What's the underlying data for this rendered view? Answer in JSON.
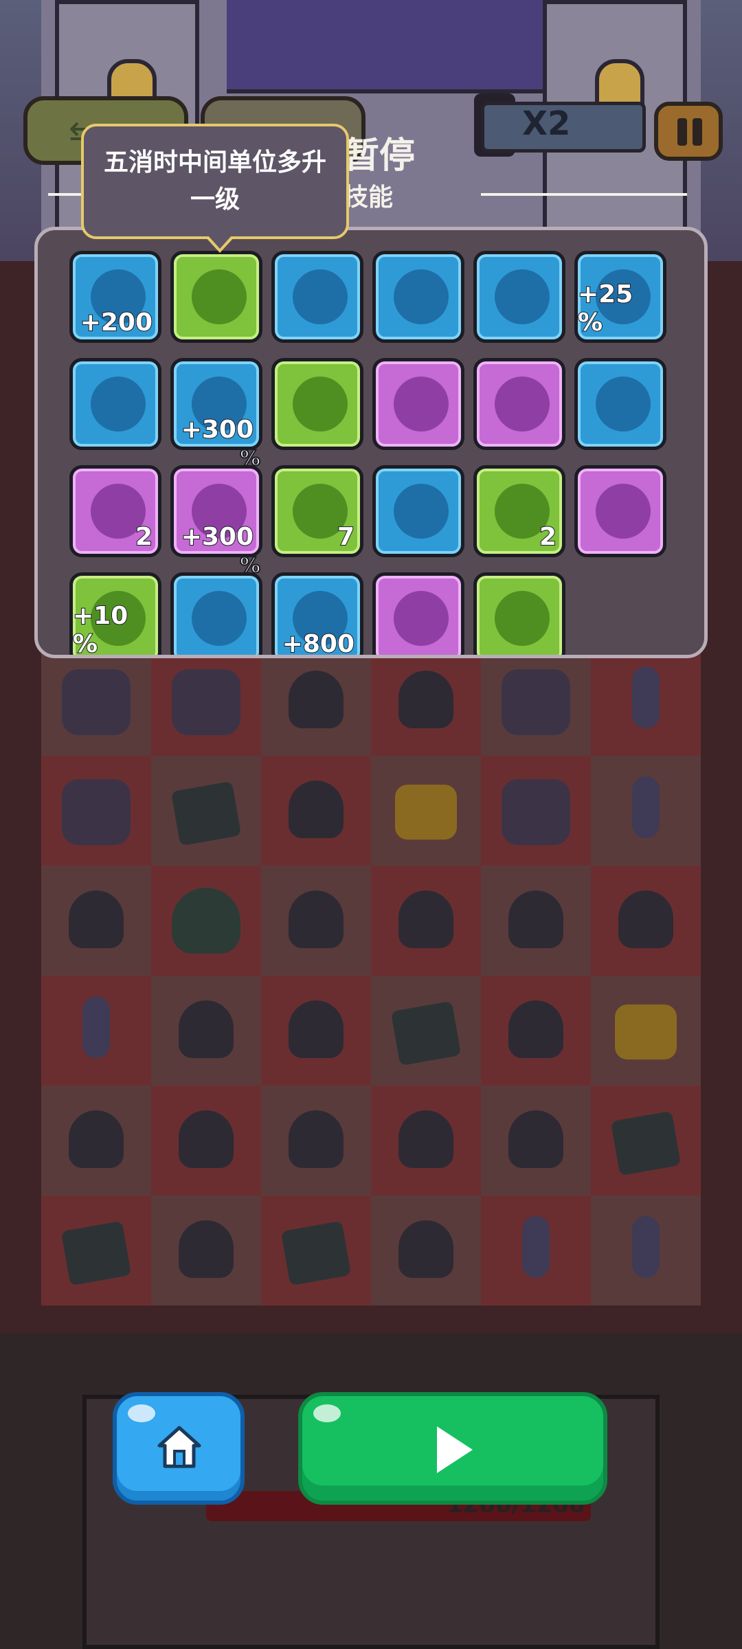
{
  "hud": {
    "speed_label": "X2",
    "pause_title": "暂停",
    "pause_subtitle": "技能"
  },
  "tooltip": {
    "text": "五消时中间单位多升一级"
  },
  "skills": [
    {
      "row": 0,
      "col": 0,
      "color": "blue",
      "icon": "winged-heart-plus-icon",
      "stat": "+200"
    },
    {
      "row": 0,
      "col": 1,
      "color": "green",
      "icon": "slime-upgrade-icon",
      "stat": ""
    },
    {
      "row": 0,
      "col": 2,
      "color": "blue",
      "icon": "vampire-bats-icon",
      "stat": ""
    },
    {
      "row": 0,
      "col": 3,
      "color": "blue",
      "icon": "tentacle-monster-icon",
      "stat": ""
    },
    {
      "row": 0,
      "col": 4,
      "color": "blue",
      "icon": "robot-area-icon",
      "stat": ""
    },
    {
      "row": 0,
      "col": 5,
      "color": "blue",
      "icon": "atk-robot-plus-icon",
      "stat": "+25 %"
    },
    {
      "row": 1,
      "col": 0,
      "color": "blue",
      "icon": "vampire-bats-swarm-icon",
      "stat": ""
    },
    {
      "row": 1,
      "col": 1,
      "color": "blue",
      "icon": "dmg-grandma-icon",
      "stat": "+300",
      "stat_below": "%"
    },
    {
      "row": 1,
      "col": 2,
      "color": "green",
      "icon": "grandma-green-aura-icon",
      "stat": ""
    },
    {
      "row": 1,
      "col": 3,
      "color": "purple",
      "icon": "vampire-bats-purple-icon",
      "stat": ""
    },
    {
      "row": 1,
      "col": 4,
      "color": "purple",
      "icon": "dizzy-grandpa-icon",
      "stat": ""
    },
    {
      "row": 1,
      "col": 5,
      "color": "blue",
      "icon": "dmg-heart-icon",
      "stat": ""
    },
    {
      "row": 2,
      "col": 0,
      "color": "purple",
      "icon": "atk-spd-slimes-icon",
      "stat": "2"
    },
    {
      "row": 2,
      "col": 1,
      "color": "purple",
      "icon": "dmg-grandma-purple-icon",
      "stat": "+300",
      "stat_below": "%"
    },
    {
      "row": 2,
      "col": 2,
      "color": "green",
      "icon": "crying-grandpa-icon",
      "stat": "7"
    },
    {
      "row": 2,
      "col": 3,
      "color": "blue",
      "icon": "poison-grandma-icon",
      "stat": ""
    },
    {
      "row": 2,
      "col": 4,
      "color": "green",
      "icon": "atk-dmg-slimes-icon",
      "stat": "2"
    },
    {
      "row": 2,
      "col": 5,
      "color": "purple",
      "icon": "vampire-swap-icon",
      "stat": ""
    },
    {
      "row": 3,
      "col": 0,
      "color": "green",
      "icon": "dmg-blob-icon",
      "stat": "+10 %"
    },
    {
      "row": 3,
      "col": 1,
      "color": "blue",
      "icon": "old-wizard-icon",
      "stat": ""
    },
    {
      "row": 3,
      "col": 2,
      "color": "blue",
      "icon": "heart-hp-icon",
      "stat": "+800"
    },
    {
      "row": 3,
      "col": 3,
      "color": "purple",
      "icon": "slime-plus-icon",
      "stat": ""
    },
    {
      "row": 3,
      "col": 4,
      "color": "green",
      "icon": "lightning-grandpas-icon",
      "stat": ""
    }
  ],
  "board": {
    "rows": [
      [
        "mech",
        "mech",
        "vampire",
        "slime-eye",
        "skeleton",
        "tower"
      ],
      [
        "mech",
        "dice",
        "vampire",
        "coin",
        "mech",
        "tower"
      ],
      [
        "claw",
        "blob",
        "claw",
        "vampire",
        "vampire",
        "vampire"
      ],
      [
        "tower",
        "claw",
        "vampire",
        "dice",
        "claw",
        "coin"
      ],
      [
        "vampire",
        "vampire",
        "claw",
        "vampire",
        "vampire",
        "dice"
      ],
      [
        "dice",
        "slime-eye",
        "dice",
        "claw",
        "tower",
        "tower"
      ]
    ]
  },
  "health": {
    "text": "1200/1200"
  },
  "colors": {
    "tooltip_border": "#e6c96a",
    "panel_bg": "#564b55",
    "home_button": "#34a8f0",
    "play_button": "#16c060",
    "tile_blue": "#2f9bd6",
    "tile_green": "#7fc23c",
    "tile_purple": "#c66ad6"
  }
}
